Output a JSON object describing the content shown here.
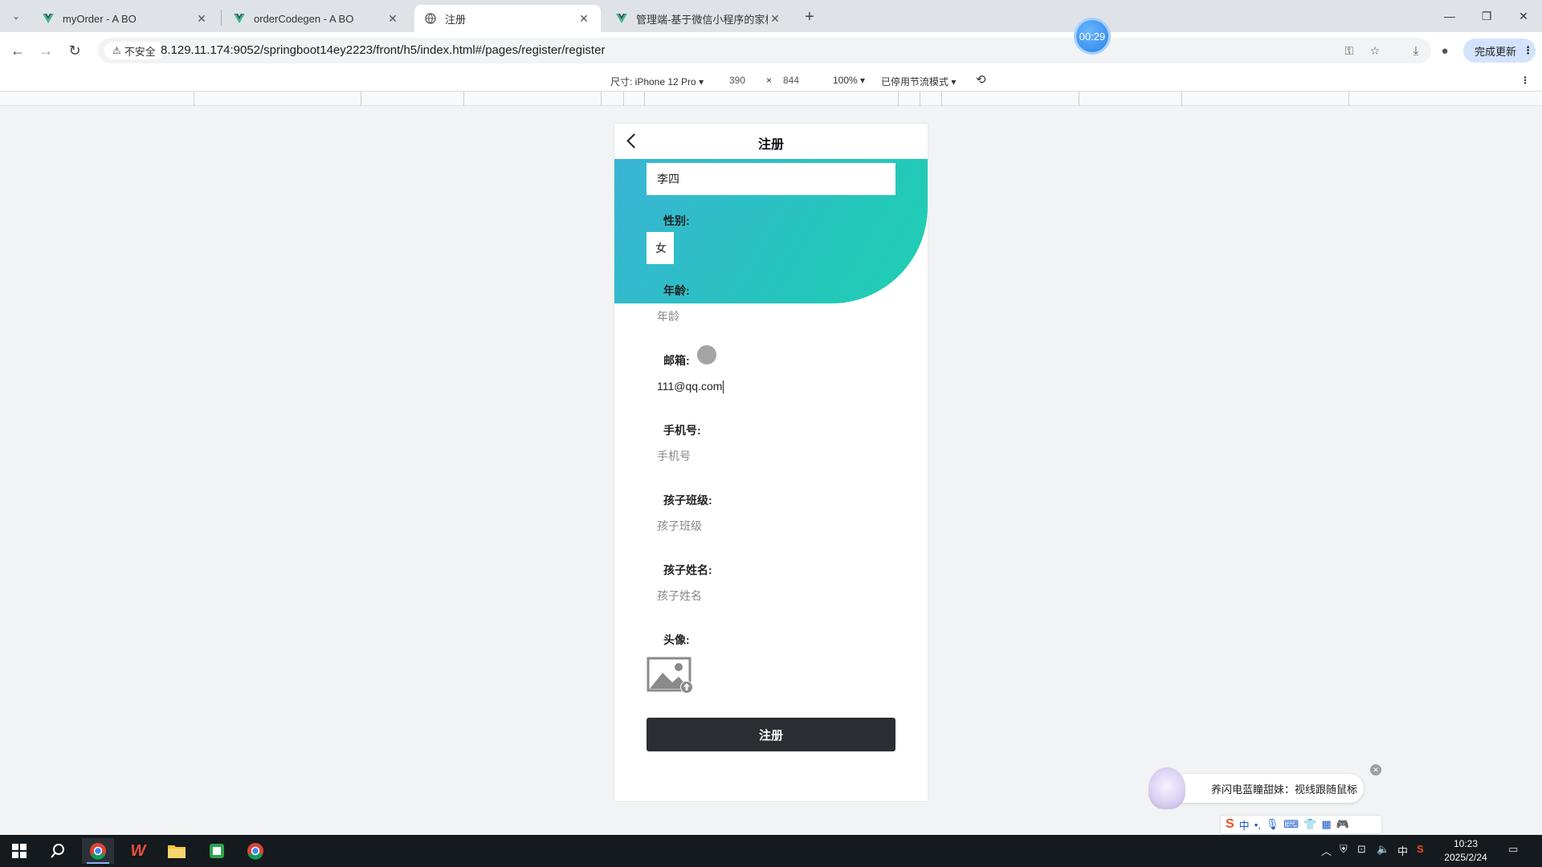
{
  "browser": {
    "tabs": [
      {
        "title": "myOrder - A BO",
        "icon": "vue-icon"
      },
      {
        "title": "orderCodegen - A BO",
        "icon": "vue-icon"
      },
      {
        "title": "注册",
        "icon": "globe-icon",
        "active": true
      },
      {
        "title": "管理端-基于微信小程序的家校",
        "icon": "vue-icon"
      }
    ],
    "security_label": "不安全",
    "url": "8.129.11.174:9052/springboot14ey2223/front/h5/index.html#/pages/register/register",
    "update_button": "完成更新",
    "recording_timer": "00:29"
  },
  "devtools": {
    "device_label": "尺寸: iPhone 12 Pro",
    "width": "390",
    "times": "×",
    "height": "844",
    "zoom": "100%",
    "throttle": "已停用节流模式"
  },
  "page": {
    "nav_title": "注册",
    "name_value": "李四",
    "gender_label": "性别:",
    "gender_value": "女",
    "age_label": "年龄:",
    "age_placeholder": "年龄",
    "email_label": "邮箱:",
    "email_value": "111@qq.com",
    "phone_label": "手机号:",
    "phone_placeholder": "手机号",
    "class_label": "孩子班级:",
    "class_placeholder": "孩子班级",
    "child_name_label": "孩子姓名:",
    "child_name_placeholder": "孩子姓名",
    "avatar_label": "头像:",
    "submit_label": "注册",
    "hero_colors": [
      "#3ab5d6",
      "#1fcfb0"
    ]
  },
  "overlay": {
    "helper_text": "养闪电蓝瞳甜妹：视线跟随鼠标",
    "ime_text": "中"
  },
  "taskbar": {
    "time": "10:23",
    "date": "2025/2/24",
    "input_lang": "中"
  }
}
